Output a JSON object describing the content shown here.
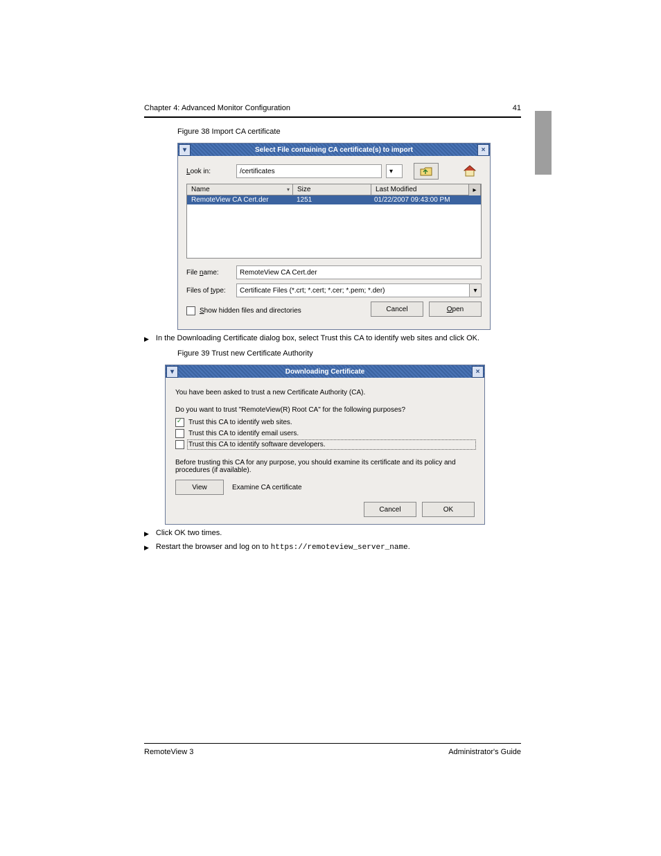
{
  "header": {
    "title_text": "Chapter 4: Advanced Monitor Configuration",
    "page_num": "41"
  },
  "footer": {
    "product": "RemoteView 3",
    "doc": "Administrator's Guide"
  },
  "fig1": {
    "caption": "Figure 38 Import CA certificate"
  },
  "fig2": {
    "caption": "Figure 39 Trust new Certificate Authority"
  },
  "bullets": {
    "b1": "In the Downloading Certificate dialog box, select Trust this CA to identify web sites and click OK.",
    "b2": "Click OK two times.",
    "b3_prefix": "Restart the browser and log on to ",
    "b3_host": "https://remoteview_server_name",
    "b3_suffix": "."
  },
  "dlg_file": {
    "title": "Select File containing CA certificate(s) to import",
    "look_in_label": "Look in:",
    "look_in_value": "/certificates",
    "cols": {
      "name": "Name",
      "size": "Size",
      "mod": "Last Modified"
    },
    "row": {
      "name": "RemoteView CA Cert.der",
      "size": "1251",
      "mod": "01/22/2007 09:43:00 PM"
    },
    "file_name_label": "File name:",
    "file_name_value": "RemoteView CA Cert.der",
    "file_type_label": "Files of type:",
    "file_type_value": "Certificate Files (*.crt; *.cert; *.cer; *.pem; *.der)",
    "show_hidden": "Show hidden files and directories",
    "cancel": "Cancel",
    "open": "Open",
    "icons": {
      "sys_left": "chevron-down-icon",
      "sys_close": "close-icon",
      "up_folder": "up-folder-icon",
      "home": "home-icon",
      "menu": "menu-icon"
    }
  },
  "dlg_cert": {
    "title": "Downloading Certificate",
    "intro": "You have been asked to trust a new Certificate Authority (CA).",
    "question": "Do you want to trust \"RemoteView(R) Root CA\" for the following purposes?",
    "opt_web": "Trust this CA to identify web sites.",
    "opt_email": "Trust this CA to identify email users.",
    "opt_dev": "Trust this CA to identify software developers.",
    "examine_note": "Before trusting this CA for any purpose, you should examine its certificate and its policy and procedures (if available).",
    "view": "View",
    "examine": "Examine CA certificate",
    "cancel": "Cancel",
    "ok": "OK"
  }
}
